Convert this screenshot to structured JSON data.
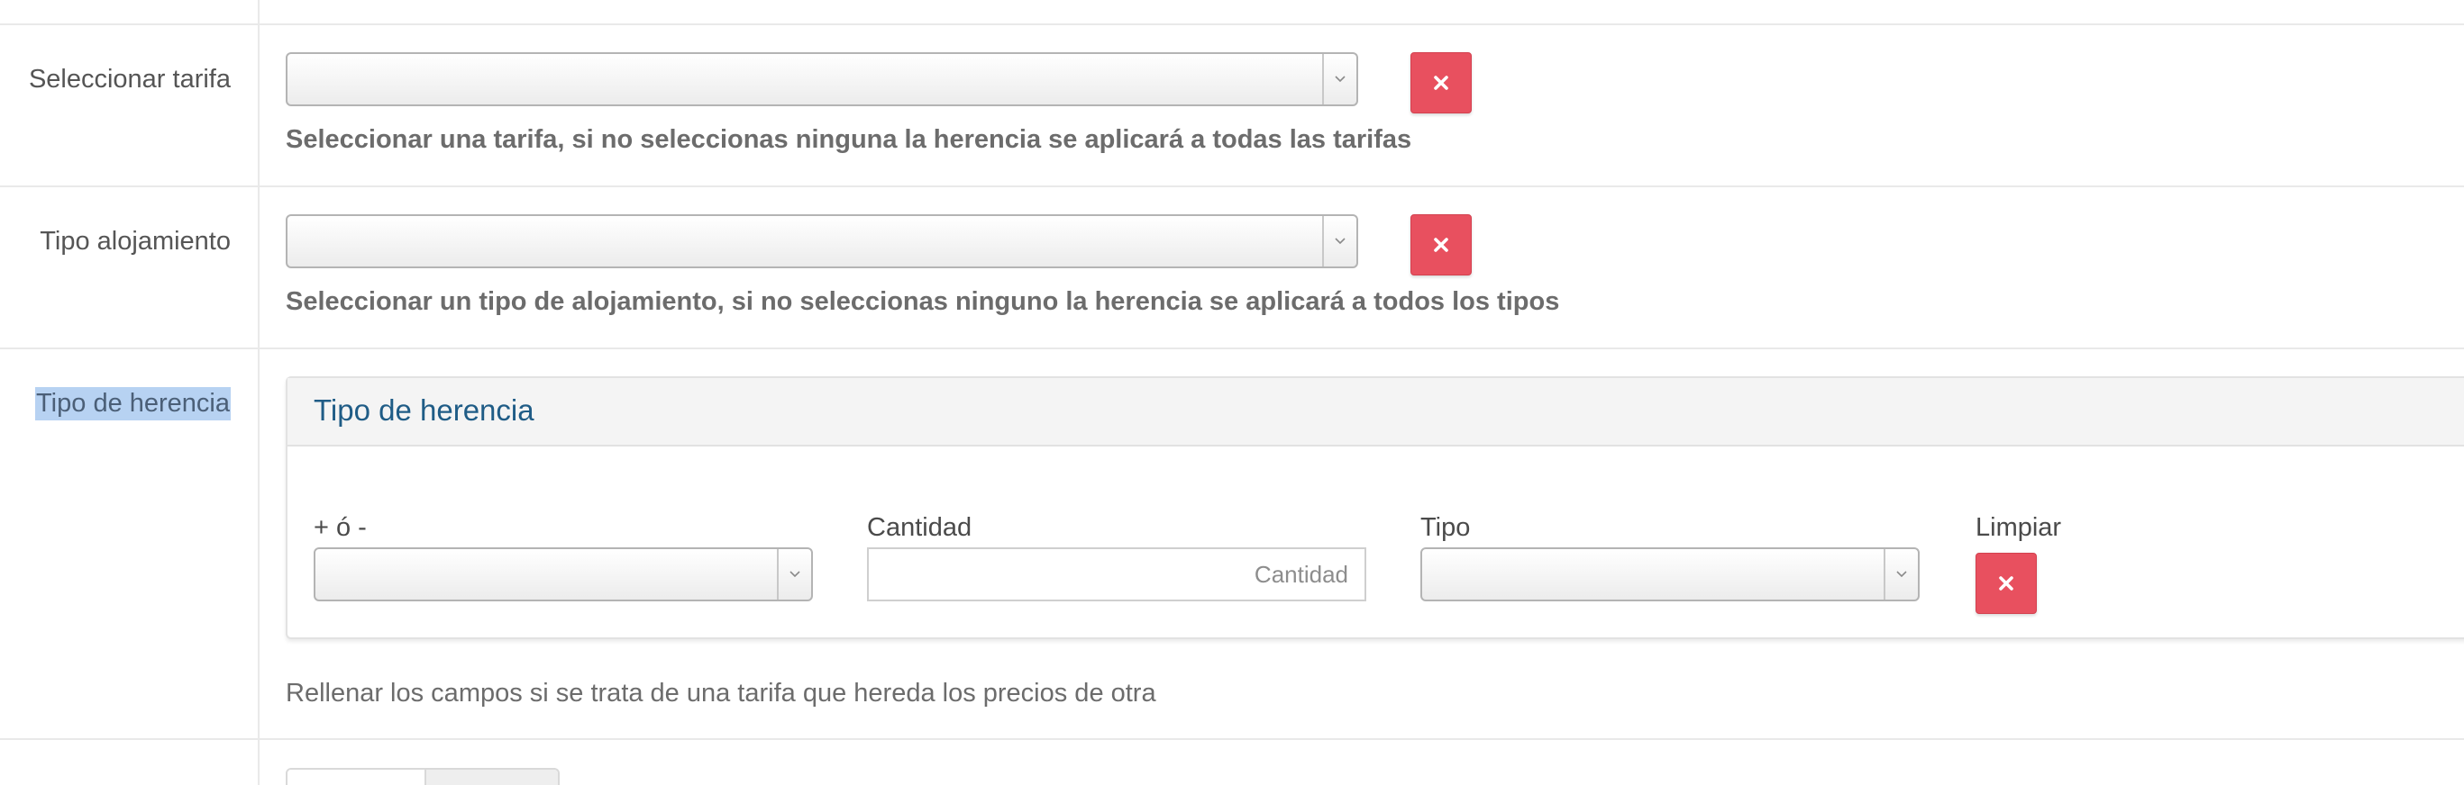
{
  "rows": {
    "tarifa": {
      "label": "Seleccionar tarifa",
      "select_value": "",
      "help": "Seleccionar una tarifa, si no seleccionas ninguna la herencia se aplicará a todas las tarifas"
    },
    "alojamiento": {
      "label": "Tipo alojamiento",
      "select_value": "",
      "help": "Seleccionar un tipo de alojamiento, si no seleccionas ninguno la herencia se aplicará a todos los tipos"
    },
    "herencia": {
      "label": "Tipo de herencia",
      "panel_title": "Tipo de herencia",
      "fields": {
        "sign_label": "+ ó -",
        "sign_value": "",
        "cantidad_label": "Cantidad",
        "cantidad_value": "",
        "cantidad_placeholder": "Cantidad",
        "tipo_label": "Tipo",
        "tipo_value": "",
        "limpiar_label": "Limpiar"
      },
      "help": "Rellenar los campos si se trata de una tarifa que hereda los precios de otra"
    }
  },
  "icons": {
    "clear": "times-icon",
    "dropdown": "chevron-down-icon"
  },
  "colors": {
    "danger": "#e8505f",
    "selection_highlight": "#b7d2f2",
    "panel_title": "#1f5c86"
  }
}
